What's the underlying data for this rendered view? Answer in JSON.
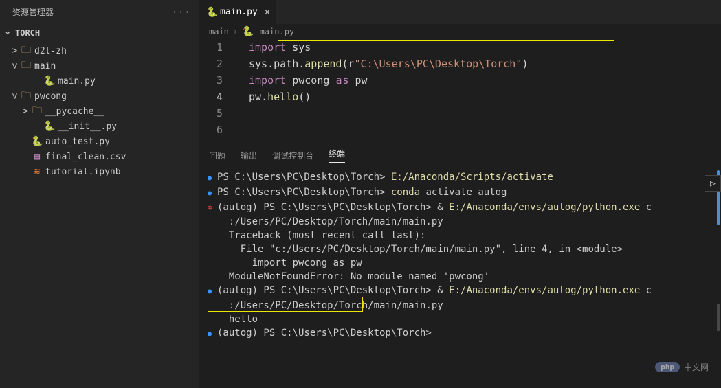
{
  "sidebar": {
    "title": "资源管理器",
    "project": "TORCH",
    "tree": [
      {
        "indent": 14,
        "chev": ">",
        "open": false,
        "icon": "folder",
        "label": "d2l-zh"
      },
      {
        "indent": 14,
        "chev": ">",
        "open": true,
        "icon": "folder",
        "label": "main"
      },
      {
        "indent": 48,
        "chev": "",
        "open": false,
        "icon": "py",
        "label": "main.py"
      },
      {
        "indent": 14,
        "chev": ">",
        "open": true,
        "icon": "folder",
        "label": "pwcong"
      },
      {
        "indent": 30,
        "chev": ">",
        "open": false,
        "icon": "folder",
        "label": "__pycache__"
      },
      {
        "indent": 48,
        "chev": "",
        "open": false,
        "icon": "py",
        "label": "__init__.py"
      },
      {
        "indent": 30,
        "chev": "",
        "open": false,
        "icon": "py",
        "label": "auto_test.py"
      },
      {
        "indent": 30,
        "chev": "",
        "open": false,
        "icon": "csv",
        "label": "final_clean.csv"
      },
      {
        "indent": 30,
        "chev": "",
        "open": false,
        "icon": "nb",
        "label": "tutorial.ipynb"
      }
    ]
  },
  "tab": {
    "filename": "main.py"
  },
  "breadcrumb": {
    "parts": [
      "main",
      "main.py"
    ]
  },
  "editor": {
    "lines": [
      {
        "n": "1",
        "html": "<span class='kw'>import</span> <span class='id'>sys</span>"
      },
      {
        "n": "2",
        "html": "<span class='id'>sys</span><span class='id'>.</span><span class='id'>path</span><span class='id'>.</span><span class='func'>append</span><span class='id'>(r</span><span class='str'>\"C:\\Users\\PC\\Desktop\\Torch\"</span><span class='id'>)</span>"
      },
      {
        "n": "3",
        "html": ""
      },
      {
        "n": "4",
        "active": true,
        "html": "<span class='kw'>import</span> <span class='id'>pwcong </span><span class='kw'>a</span><span class='kw cursor-char'>s</span> <span class='id'>pw</span>"
      },
      {
        "n": "5",
        "html": ""
      },
      {
        "n": "6",
        "html": "<span class='id'>pw</span><span class='id'>.</span><span class='func'>hello</span><span class='id'>()</span>"
      }
    ]
  },
  "panel": {
    "tabs": [
      "问题",
      "输出",
      "调试控制台",
      "终端"
    ],
    "active": 3
  },
  "terminal": {
    "lines": [
      {
        "dot": "blue",
        "segs": [
          {
            "c": "plain",
            "t": "PS C:\\Users\\PC\\Desktop\\Torch> "
          },
          {
            "c": "pth",
            "t": "E:/Anaconda/Scripts/activate"
          }
        ]
      },
      {
        "dot": "blue",
        "segs": [
          {
            "c": "plain",
            "t": "PS C:\\Users\\PC\\Desktop\\Torch> "
          },
          {
            "c": "cmd",
            "t": "conda"
          },
          {
            "c": "plain",
            "t": " activate autog"
          }
        ]
      },
      {
        "dot": "red",
        "segs": [
          {
            "c": "plain",
            "t": "(autog) PS C:\\Users\\PC\\Desktop\\Torch> & "
          },
          {
            "c": "pth",
            "t": "E:/Anaconda/envs/autog/python.exe"
          },
          {
            "c": "plain",
            "t": " c"
          }
        ]
      },
      {
        "dot": "",
        "segs": [
          {
            "c": "plain",
            "t": "  :/Users/PC/Desktop/Torch/main/main.py"
          }
        ]
      },
      {
        "dot": "",
        "segs": [
          {
            "c": "plain",
            "t": "  Traceback (most recent call last):"
          }
        ]
      },
      {
        "dot": "",
        "segs": [
          {
            "c": "plain",
            "t": "    File \"c:/Users/PC/Desktop/Torch/main/main.py\", line 4, in <module>"
          }
        ]
      },
      {
        "dot": "",
        "segs": [
          {
            "c": "plain",
            "t": "      import pwcong as pw"
          }
        ]
      },
      {
        "dot": "",
        "segs": [
          {
            "c": "plain",
            "t": "  ModuleNotFoundError: No module named 'pwcong'"
          }
        ]
      },
      {
        "dot": "blue",
        "segs": [
          {
            "c": "plain",
            "t": "(autog) PS C:\\Users\\PC\\Desktop\\Torch> & "
          },
          {
            "c": "pth",
            "t": "E:/Anaconda/envs/autog/python.exe"
          },
          {
            "c": "plain",
            "t": " c"
          }
        ]
      },
      {
        "dot": "",
        "segs": [
          {
            "c": "plain",
            "t": "  :/Users/PC/Desktop/Torch/main/main.py"
          }
        ]
      },
      {
        "dot": "",
        "segs": [
          {
            "c": "plain",
            "t": "  hello"
          }
        ]
      },
      {
        "dot": "blue",
        "segs": [
          {
            "c": "plain",
            "t": "(autog) PS C:\\Users\\PC\\Desktop\\Torch> "
          }
        ]
      }
    ]
  },
  "watermark": {
    "badge": "php",
    "text": "中文网"
  }
}
